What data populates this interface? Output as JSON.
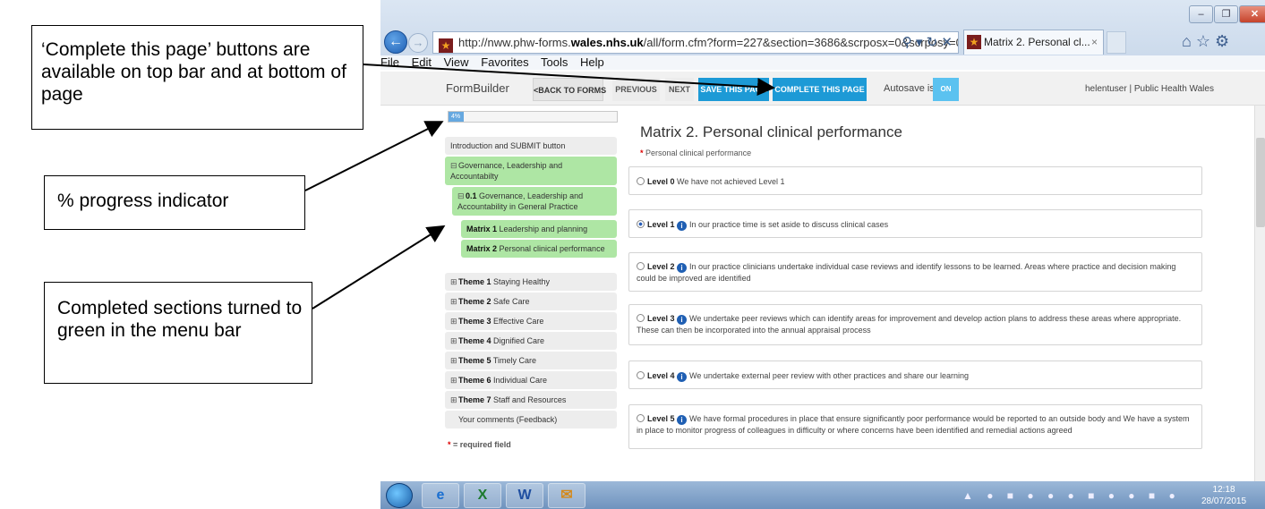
{
  "browser": {
    "url_prefix": "http://nww.phw-forms.",
    "url_domain": "wales.nhs.uk",
    "url_suffix": "/all/form.cfm?form=227&section=3686&scrposx=0&scrposy=0",
    "tab_title": "Matrix 2. Personal cl...",
    "tab_close": "×",
    "menu": [
      "File",
      "Edit",
      "View",
      "Favorites",
      "Tools",
      "Help"
    ],
    "icons": [
      "back-arrow-icon",
      "forward-arrow-icon",
      "search-icon",
      "refresh-icon",
      "stop-icon",
      "home-icon",
      "favorites-star-icon",
      "gear-icon"
    ]
  },
  "toolbar": {
    "logo": "FormBuilder",
    "back_to_forms": "<BACK TO FORMS",
    "previous": "PREVIOUS",
    "next": "NEXT",
    "save": "SAVE THIS PAGE",
    "complete": "COMPLETE THIS PAGE",
    "autosave_label": "Autosave is",
    "autosave_state": "ON",
    "user": "helentuser | Public Health Wales"
  },
  "progress": {
    "label": "4%",
    "value": 0.04
  },
  "nav": [
    {
      "key": "intro",
      "text": "Introduction and SUBMIT button"
    },
    {
      "key": "gov",
      "text": "Governance, Leadership and Accountabilty"
    },
    {
      "key": "gov01_num",
      "text": "0.1"
    },
    {
      "key": "gov01",
      "text": " Governance, Leadership and Accountability in General Practice"
    },
    {
      "key": "m1_num",
      "text": "Matrix 1"
    },
    {
      "key": "m1",
      "text": " Leadership and planning"
    },
    {
      "key": "m2_num",
      "text": "Matrix 2"
    },
    {
      "key": "m2",
      "text": " Personal clinical performance"
    }
  ],
  "themes": [
    {
      "bold": "Theme 1",
      "text": " Staying Healthy"
    },
    {
      "bold": "Theme 2",
      "text": " Safe Care"
    },
    {
      "bold": "Theme 3",
      "text": " Effective Care"
    },
    {
      "bold": "Theme 4",
      "text": " Dignified Care"
    },
    {
      "bold": "Theme 5",
      "text": " Timely Care"
    },
    {
      "bold": "Theme 6",
      "text": " Individual Care"
    },
    {
      "bold": "Theme 7",
      "text": " Staff and Resources"
    }
  ],
  "feedback": "Your comments (Feedback)",
  "required_note": "= required field",
  "form": {
    "title": "Matrix 2. Personal clinical performance",
    "subtitle": "Personal clinical performance",
    "levels": [
      {
        "label": "Level 0",
        "text": " We have not achieved Level 1",
        "selected": false
      },
      {
        "label": "Level 1",
        "text": "In our practice time is set aside to discuss clinical cases",
        "selected": true
      },
      {
        "label": "Level 2",
        "text": "In our practice clinicians undertake individual case reviews and identify lessons to be learned. Areas where practice and decision making could be improved are identified",
        "selected": false
      },
      {
        "label": "Level 3",
        "text": "We undertake peer reviews which can identify areas for improvement and develop action plans to address these areas where appropriate. These can then be incorporated into the annual appraisal process",
        "selected": false
      },
      {
        "label": "Level 4",
        "text": "We undertake external peer review with other practices and share our learning",
        "selected": false
      },
      {
        "label": "Level 5",
        "text": "We have formal procedures in place that ensure significantly poor performance would be reported to an outside body and We have a system in place to monitor progress of colleagues in difficulty or where concerns have been identified and remedial actions agreed",
        "selected": false
      }
    ]
  },
  "taskbar": {
    "clock_time": "12:18",
    "clock_date": "28/07/2015",
    "apps": [
      "internet-explorer-icon",
      "excel-icon",
      "word-icon",
      "outlook-icon"
    ]
  },
  "callouts": {
    "complete": "‘Complete this page’ buttons are available on top bar and at bottom of page",
    "progress": "% progress indicator",
    "green": "Completed sections turned to green in the menu bar"
  },
  "colors": {
    "accent_blue": "#1d9ad6",
    "completed_green": "#aee6a4",
    "nav_grey": "#ededed"
  }
}
